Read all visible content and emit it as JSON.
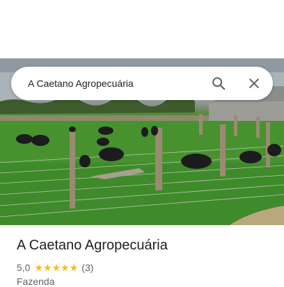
{
  "search": {
    "query": "A Caetano Agropecuária"
  },
  "place": {
    "name": "A Caetano Agropecuária",
    "rating": "5,0",
    "stars": 5,
    "review_count": "(3)",
    "category": "Fazenda"
  },
  "icons": {
    "search": "search-icon",
    "close": "close-icon",
    "star": "star-icon"
  },
  "colors": {
    "star": "#fbbc04",
    "icon": "#5f6368",
    "title": "#202124"
  },
  "photo": {
    "subject": "photo of black sheep grazing in a green fenced pasture"
  }
}
